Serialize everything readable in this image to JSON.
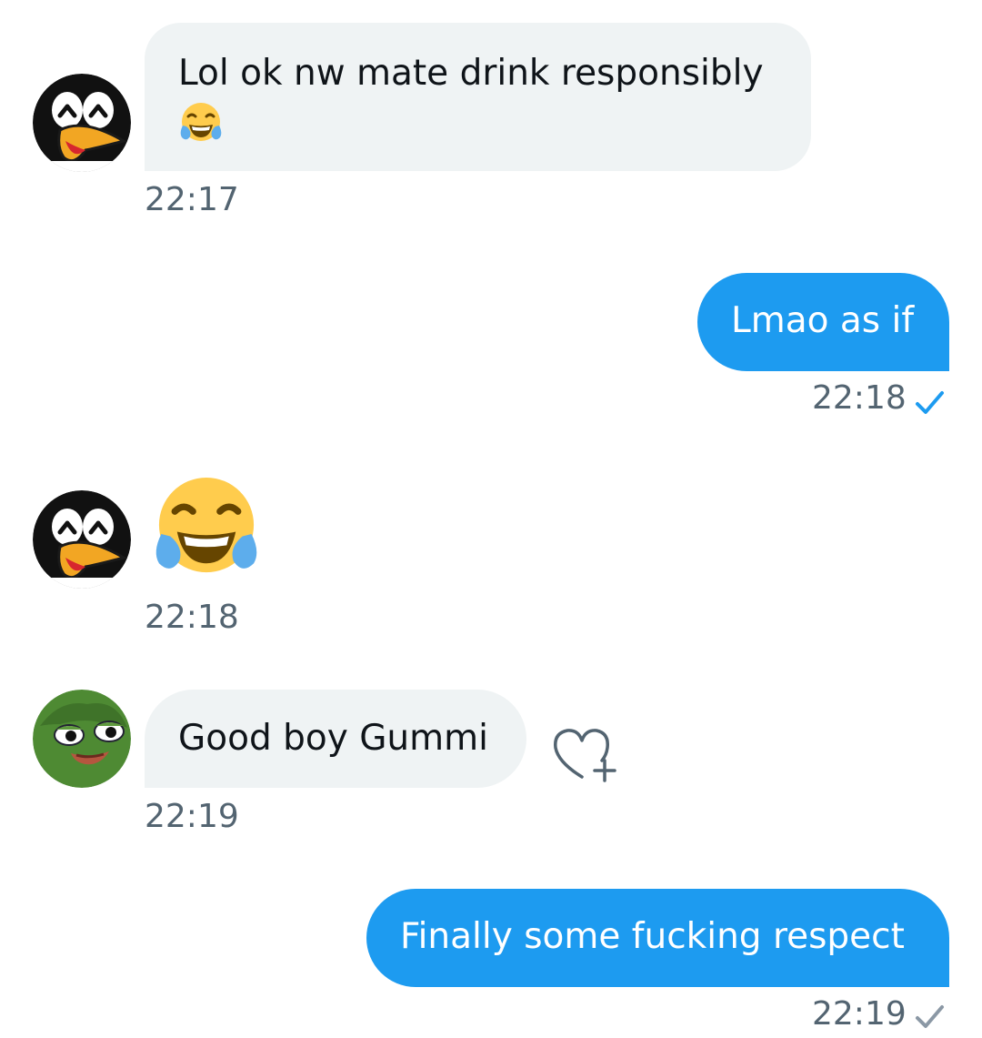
{
  "conversation": {
    "messages": [
      {
        "direction": "incoming",
        "sender_avatar": "penguin-avatar",
        "text": "Lol ok nw mate drink responsibly",
        "emoji": "face-with-tears-of-joy",
        "time": "22:17"
      },
      {
        "direction": "outgoing",
        "text": "Lmao as if",
        "time": "22:18",
        "status": "seen"
      },
      {
        "direction": "incoming",
        "sender_avatar": "penguin-avatar",
        "emoji": "face-with-tears-of-joy",
        "time": "22:18"
      },
      {
        "direction": "incoming",
        "sender_avatar": "frog-avatar",
        "text": "Good boy Gummi",
        "time": "22:19",
        "reaction_button": "add-reaction-icon"
      },
      {
        "direction": "outgoing",
        "text": "Finally some fucking respect",
        "time": "22:19",
        "status": "sent"
      }
    ]
  },
  "colors": {
    "outgoing_bubble": "#1d9bf0",
    "incoming_bubble": "#eff3f4",
    "timestamp": "#536471",
    "check_seen": "#1d9bf0",
    "check_sent": "#8b98a5"
  }
}
